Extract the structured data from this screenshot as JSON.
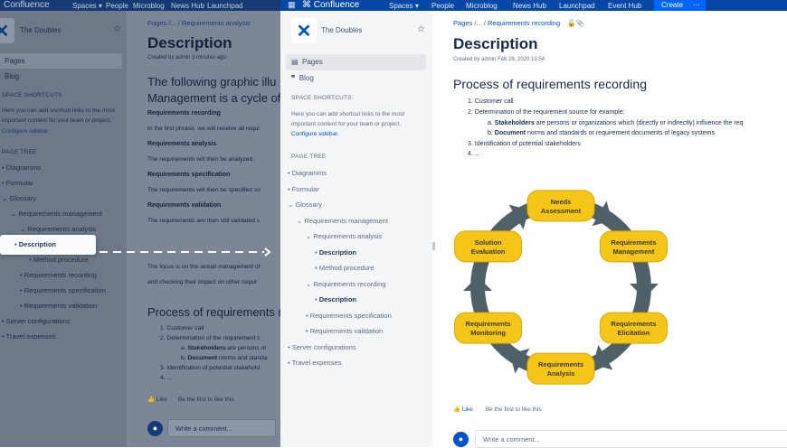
{
  "nav": {
    "brand": "Confluence",
    "items": [
      "Spaces ▾",
      "People",
      "Microblog",
      "News Hub",
      "Launchpad",
      "Event Hub"
    ],
    "create": "Create",
    "more": "···"
  },
  "space": {
    "name": "The Doubles",
    "pages": "Pages",
    "blog": "Blog",
    "shortcuts_label": "SPACE SHORTCUTS",
    "shortcuts_text_1": "Here you can add shortcut links to the most",
    "shortcuts_text_2": "important content for your team or project.",
    "configure": "Configure sidebar.",
    "tree_label": "PAGE TREE"
  },
  "bg_tree": [
    {
      "label": "Diagramms",
      "level": 0,
      "marker": "•"
    },
    {
      "label": "Formular",
      "level": 0,
      "marker": "•"
    },
    {
      "label": "Glossary",
      "level": 0,
      "marker": "⌄"
    },
    {
      "label": "Requirements management",
      "level": 1,
      "marker": "⌄"
    },
    {
      "label": "Requirements analysis",
      "level": 2,
      "marker": "⌄"
    },
    {
      "label": "Description",
      "level": 3,
      "marker": "•",
      "bold": true
    },
    {
      "label": "Method procedure",
      "level": 3,
      "marker": "•"
    },
    {
      "label": "Requirements recording",
      "level": 2,
      "marker": "•"
    },
    {
      "label": "Requirements specification",
      "level": 2,
      "marker": "•"
    },
    {
      "label": "Requirements validation",
      "level": 2,
      "marker": "•"
    },
    {
      "label": "Server configurations",
      "level": 0,
      "marker": "•"
    },
    {
      "label": "Travel expenses",
      "level": 0,
      "marker": "•"
    }
  ],
  "fg_tree": [
    {
      "label": "Diagramms",
      "level": 0,
      "marker": "•"
    },
    {
      "label": "Formular",
      "level": 0,
      "marker": "•"
    },
    {
      "label": "Glossary",
      "level": 0,
      "marker": "⌄"
    },
    {
      "label": "Requirements management",
      "level": 1,
      "marker": "⌄"
    },
    {
      "label": "Requirements analysis",
      "level": 2,
      "marker": "⌄"
    },
    {
      "label": "Description",
      "level": 3,
      "marker": "•",
      "bold": true
    },
    {
      "label": "Method procedure",
      "level": 3,
      "marker": "•"
    },
    {
      "label": "Requirements recording",
      "level": 2,
      "marker": "⌄"
    },
    {
      "label": "Description",
      "level": 3,
      "marker": "•",
      "bold": true
    },
    {
      "label": "Requirements specification",
      "level": 2,
      "marker": "•"
    },
    {
      "label": "Requirements validation",
      "level": 2,
      "marker": "•"
    },
    {
      "label": "Server configurations",
      "level": 0,
      "marker": "•"
    },
    {
      "label": "Travel expenses",
      "level": 0,
      "marker": "•"
    }
  ],
  "bg_page": {
    "breadcrumb": "Pages /... / Requirements analysis",
    "title": "Description",
    "created": "Created by admin 3 minutes ago",
    "intro_1": "The following graphic illu",
    "intro_2": "Management is a cycle of",
    "sections": [
      {
        "h": "Requirements recording",
        "t": "In the first phrase, we will receive all requi"
      },
      {
        "h": "Requirements analysis",
        "t": "The requirements will then be analyzed."
      },
      {
        "h": "Requirements specification",
        "t": "The requirements will then be specified so"
      },
      {
        "h": "Requirements validation",
        "t": "The requirements are then still validated s"
      }
    ],
    "focus_1": "The focus is on the actual management of",
    "focus_2": "and checking their impact on other requir",
    "process": "Process of requirements r",
    "list": [
      "1. Customer call",
      "2. Determination of the requirement s",
      "3. Identification of potential stakehold",
      "4. ..."
    ],
    "sub_a_b": "Stakeholders",
    "sub_a": " are persons or",
    "sub_b_b": "Document",
    "sub_b": " norms and standa",
    "like": "Like",
    "like_text": "Be the first to like this",
    "comment": "Write a comment..."
  },
  "fg_page": {
    "breadcrumb_pages": "Pages",
    "breadcrumb_sep": "/... /",
    "breadcrumb_current": "Requirements recording",
    "title": "Description",
    "created": "Created by admin Feb 28, 2020 13:54",
    "process": "Process of requirements recording",
    "list": [
      "1. Customer call",
      "2. Determination of the requirement source for example:",
      "3. Identification of potential stakeholders",
      "4. ..."
    ],
    "sub_a_prefix": "a.",
    "sub_a_b": "Stakeholders",
    "sub_a": " are persons or organizations which (directly or indirectly) influence the req",
    "sub_b_prefix": "b.",
    "sub_b_b": "Document",
    "sub_b": " norms and standards or requirement documents of legacy systems",
    "like": "Like",
    "like_text": "Be the first to like this",
    "comment": "Write a comment..."
  },
  "diagram": {
    "nodes": [
      [
        "Needs",
        "Assessment"
      ],
      [
        "Requirements",
        "Management"
      ],
      [
        "Requirements",
        "Elicitation"
      ],
      [
        "Requirements",
        "Analysis"
      ],
      [
        "Requirements",
        "Monitoring"
      ],
      [
        "Solution",
        "Evaluation"
      ]
    ],
    "node_color": "#f5c518",
    "arrow_color": "#4f6067"
  }
}
